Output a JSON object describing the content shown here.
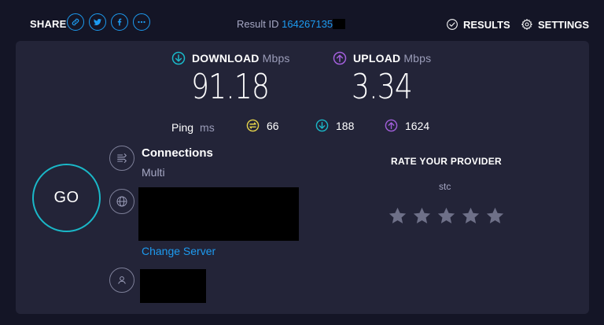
{
  "header": {
    "share_label": "SHARE",
    "share_buttons": [
      "link-icon",
      "twitter-icon",
      "facebook-icon",
      "more-icon"
    ],
    "result_label": "Result ID",
    "result_id": "164267135",
    "results_label": "RESULTS",
    "settings_label": "SETTINGS"
  },
  "download": {
    "label": "DOWNLOAD",
    "unit": "Mbps",
    "value": "91.18",
    "color": "#1ab8c8"
  },
  "upload": {
    "label": "UPLOAD",
    "unit": "Mbps",
    "value": "3.34",
    "color": "#a25fdb"
  },
  "ping": {
    "label": "Ping",
    "unit": "ms",
    "idle": "66",
    "download": "188",
    "upload": "1624",
    "idle_color": "#e5d34a"
  },
  "go_label": "GO",
  "connections": {
    "title": "Connections",
    "value": "Multi"
  },
  "server": {
    "change_label": "Change Server"
  },
  "rating": {
    "title": "RATE YOUR PROVIDER",
    "provider": "stc",
    "stars": 5,
    "star_color": "#6e7088"
  },
  "colors": {
    "background": "#141526",
    "panel": "#232438",
    "accent": "#1d9bf0"
  }
}
